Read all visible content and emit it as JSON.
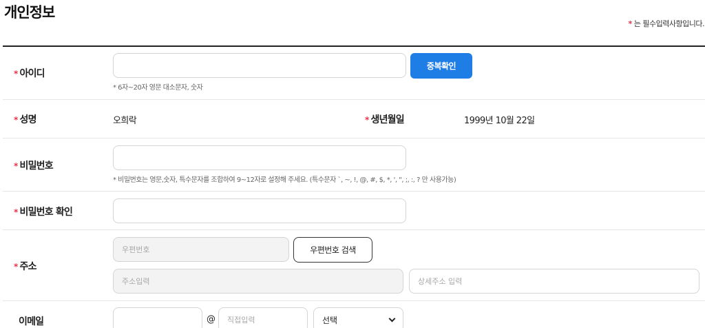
{
  "page": {
    "title": "개인정보",
    "required_mark": "*",
    "required_note": "는 필수입력사항입니다."
  },
  "fields": {
    "user_id": {
      "label": "아이디",
      "value": "",
      "placeholder": "",
      "button": "중복확인",
      "help": "* 6자~20자 영문 대소문자, 숫자"
    },
    "name": {
      "label": "성명",
      "value": "오희락"
    },
    "birthdate": {
      "label": "생년월일",
      "value": "1999년 10월 22일"
    },
    "password": {
      "label": "비밀번호",
      "value": "",
      "help": "* 비밀번호는 영문,숫자, 특수문자를 조합하여 9~12자로 설정해 주세요. (특수문자 `, ~, !, @, #, $, *, ', \", ;, :, ? 만 사용가능)"
    },
    "password_confirm": {
      "label": "비밀번호 확인",
      "value": ""
    },
    "address": {
      "label": "주소",
      "postcode_placeholder": "우편번호",
      "search_button": "우편번호 검색",
      "address_placeholder": "주소입력",
      "detail_placeholder": "상세주소 입력"
    },
    "email": {
      "label": "이메일",
      "local_value": "",
      "at": "@",
      "domain_placeholder": "직접입력",
      "select_value": "선택"
    }
  },
  "colors": {
    "required": "#e8334a",
    "primary_button": "#1f7ee6",
    "border": "#d4d4d4",
    "disabled_bg": "#f3f3f3"
  }
}
